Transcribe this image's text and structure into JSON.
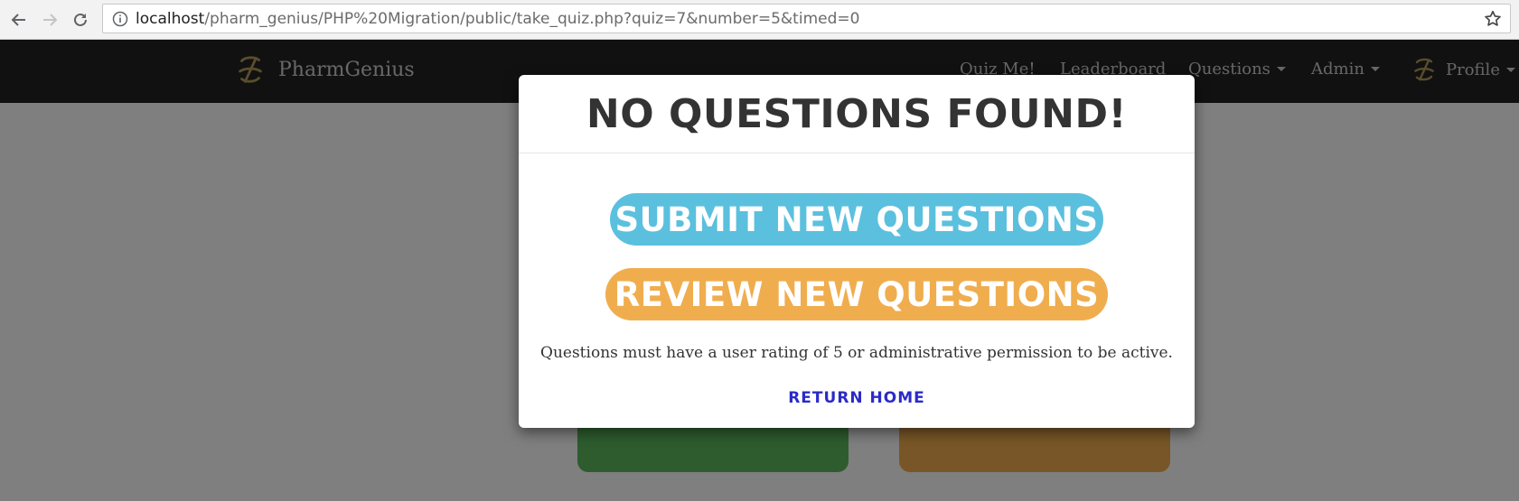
{
  "browser": {
    "url_host": "localhost",
    "url_path": "/pharm_genius/PHP%20Migration/public/take_quiz.php?quiz=7&number=5&timed=0",
    "back_icon": "arrow-left-icon",
    "forward_icon": "arrow-right-icon",
    "reload_icon": "reload-icon",
    "info_icon": "info-icon",
    "bookmark_icon": "star-icon"
  },
  "navbar": {
    "brand": "PharmGenius",
    "items": [
      {
        "label": "Quiz Me!",
        "dropdown": false
      },
      {
        "label": "Leaderboard",
        "dropdown": false
      },
      {
        "label": "Questions",
        "dropdown": true
      },
      {
        "label": "Admin",
        "dropdown": true
      }
    ],
    "profile_label": "Profile"
  },
  "modal": {
    "title": "NO QUESTIONS FOUND!",
    "submit_label": "SUBMIT NEW QUESTIONS",
    "review_label": "REVIEW NEW QUESTIONS",
    "note": "Questions must have a user rating of 5 or administrative permission to be active.",
    "return_label": "RETURN HOME"
  },
  "colors": {
    "submit_button": "#5bc0de",
    "review_button": "#f0ad4e",
    "return_link": "#2b2bc7",
    "navbar_bg": "#222222",
    "tile_green": "#5cb85c",
    "tile_orange": "#f0ad4e"
  }
}
